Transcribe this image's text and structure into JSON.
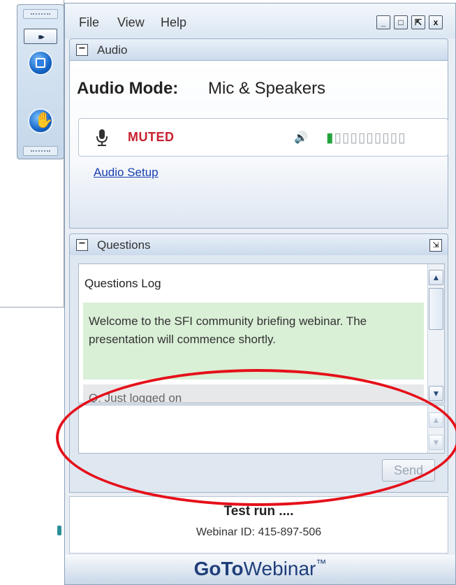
{
  "menu": {
    "file": "File",
    "view": "View",
    "help": "Help"
  },
  "window_controls": {
    "minimize": "_",
    "maximize": "□",
    "popout": "⇱",
    "close": "x"
  },
  "toolbar": {
    "forward_label": "▸▸"
  },
  "audio": {
    "section_title": "Audio",
    "collapse_symbol": "−",
    "mode_label": "Audio Mode:",
    "mode_value": "Mic & Speakers",
    "mic_status": "MUTED",
    "speaker_symbol": "🔊",
    "level_on": "▮",
    "level_off": "▯▯▯▯▯▯▯▯▯",
    "setup_link": "Audio Setup"
  },
  "questions": {
    "section_title": "Questions",
    "collapse_symbol": "−",
    "log_title": "Questions Log",
    "messages": [
      "Welcome to the SFI community briefing webinar. The presentation will commence shortly.",
      "Q: Just logged on"
    ],
    "input_value": "",
    "send_label": "Send"
  },
  "session": {
    "title": "Test run ....",
    "webinar_id": "Webinar ID: 415-897-506"
  },
  "brand": {
    "part1": "GoTo",
    "part2": "Webinar",
    "tm": "™"
  },
  "colors": {
    "muted_red": "#c8202f",
    "link_blue": "#1a3fb0",
    "annotation_red": "#e5101a",
    "level_green": "#22a33a"
  }
}
